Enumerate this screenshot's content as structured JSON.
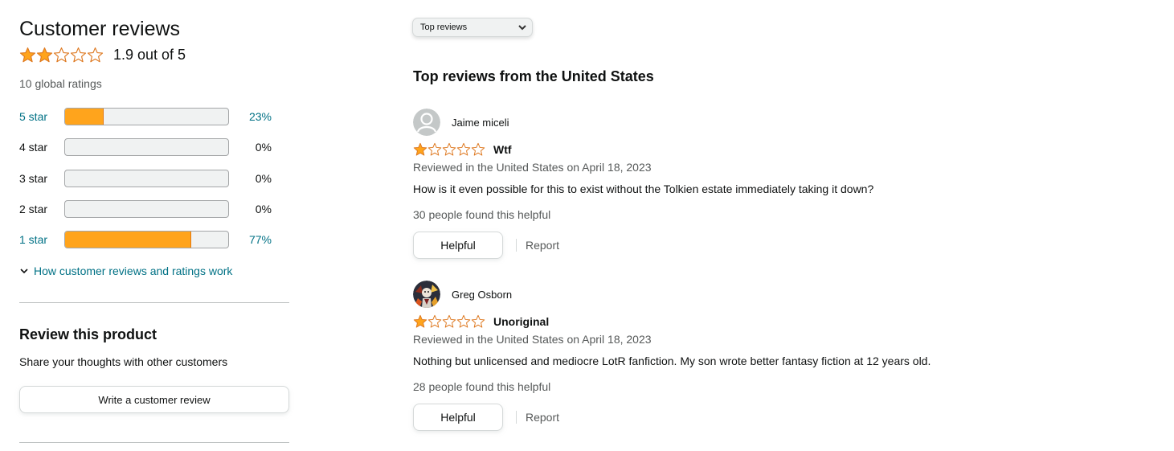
{
  "colors": {
    "star": "#ffa41c",
    "star_stroke": "#de7921",
    "link": "#007185",
    "bar_fill": "#ffa41c"
  },
  "summary": {
    "title": "Customer reviews",
    "rating_value": 1.9,
    "rating_text": "1.9 out of 5",
    "global_ratings": "10 global ratings",
    "histogram": [
      {
        "label": "5 star",
        "percent_text": "23%",
        "percent": 23,
        "link": true
      },
      {
        "label": "4 star",
        "percent_text": "0%",
        "percent": 0,
        "link": false
      },
      {
        "label": "3 star",
        "percent_text": "0%",
        "percent": 0,
        "link": false
      },
      {
        "label": "2 star",
        "percent_text": "0%",
        "percent": 0,
        "link": false
      },
      {
        "label": "1 star",
        "percent_text": "77%",
        "percent": 77,
        "link": true
      }
    ],
    "how_link": "How customer reviews and ratings work",
    "how_icon": "chevron-down-icon"
  },
  "write_review": {
    "heading": "Review this product",
    "subtext": "Share your thoughts with other customers",
    "button_label": "Write a customer review"
  },
  "sort": {
    "selected": "Top reviews",
    "icon": "chevron-down-icon"
  },
  "reviews_heading": "Top reviews from the United States",
  "reviews": [
    {
      "reviewer": "Jaime miceli",
      "avatar": "default-avatar-icon",
      "stars": 1,
      "title": "Wtf",
      "date": "Reviewed in the United States on April 18, 2023",
      "body": "How is it even possible for this to exist without the Tolkien estate immediately taking it down?",
      "helpful_count": "30 people found this helpful",
      "helpful_label": "Helpful",
      "report_label": "Report"
    },
    {
      "reviewer": "Greg Osborn",
      "avatar": "photo-avatar",
      "stars": 1,
      "title": "Unoriginal",
      "date": "Reviewed in the United States on April 18, 2023",
      "body": "Nothing but unlicensed and mediocre LotR fanfiction. My son wrote better fantasy fiction at 12 years old.",
      "helpful_count": "28 people found this helpful",
      "helpful_label": "Helpful",
      "report_label": "Report"
    }
  ]
}
